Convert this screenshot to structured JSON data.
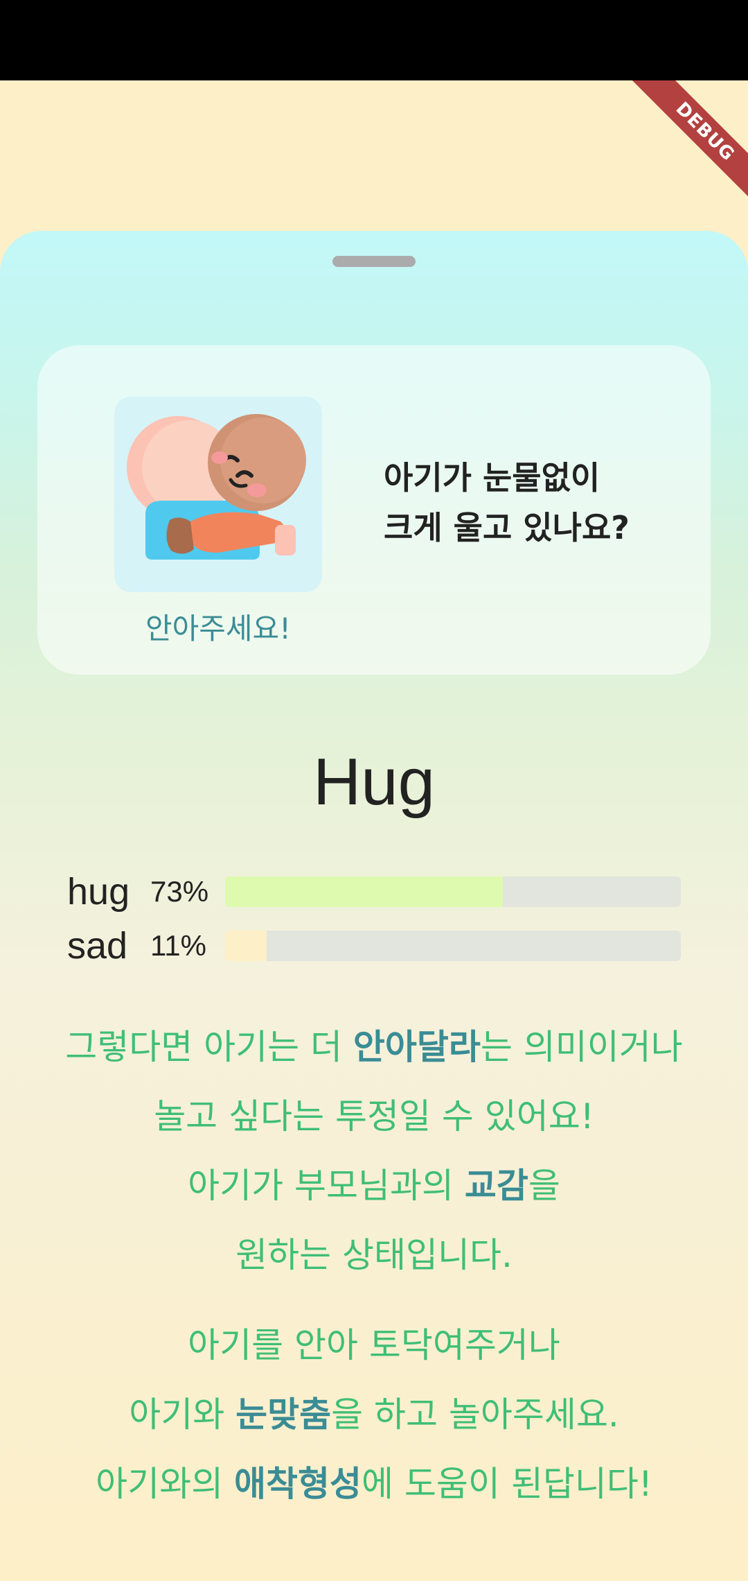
{
  "debug_banner": {
    "label": "DEBUG"
  },
  "card": {
    "icon_name": "baby-hug-icon",
    "caption": "안아주세요!",
    "question_line1": "아기가 눈물없이",
    "question_line2": "크게 울고 있나요?"
  },
  "result": {
    "title": "Hug",
    "bars": [
      {
        "label": "hug",
        "percent_text": "73%",
        "value": 0.73,
        "color": "#DDFAAE"
      },
      {
        "label": "sad",
        "percent_text": "11%",
        "value": 0.11,
        "color": "#FDEFC8"
      }
    ]
  },
  "message": {
    "p1": {
      "l1_a": "그렇다면 아기는 더 ",
      "l1_em": "안아달라",
      "l1_b": "는 의미이거나",
      "l2": "놀고 싶다는 투정일 수 있어요!",
      "l3_a": "아기가 부모님과의 ",
      "l3_em": "교감",
      "l3_b": "을",
      "l4": "원하는 상태입니다."
    },
    "p2": {
      "l1": "아기를 안아 토닥여주거나",
      "l2_a": "아기와 ",
      "l2_em": "눈맞춤",
      "l2_b": "을 하고 놀아주세요.",
      "l3_a": "아기와의 ",
      "l3_em": "애착형성",
      "l3_b": "에 도움이 된답니다!"
    }
  },
  "colors": {
    "accent_green": "#3FBE76",
    "accent_teal": "#3A8C95",
    "background": "#FDEFC8"
  }
}
